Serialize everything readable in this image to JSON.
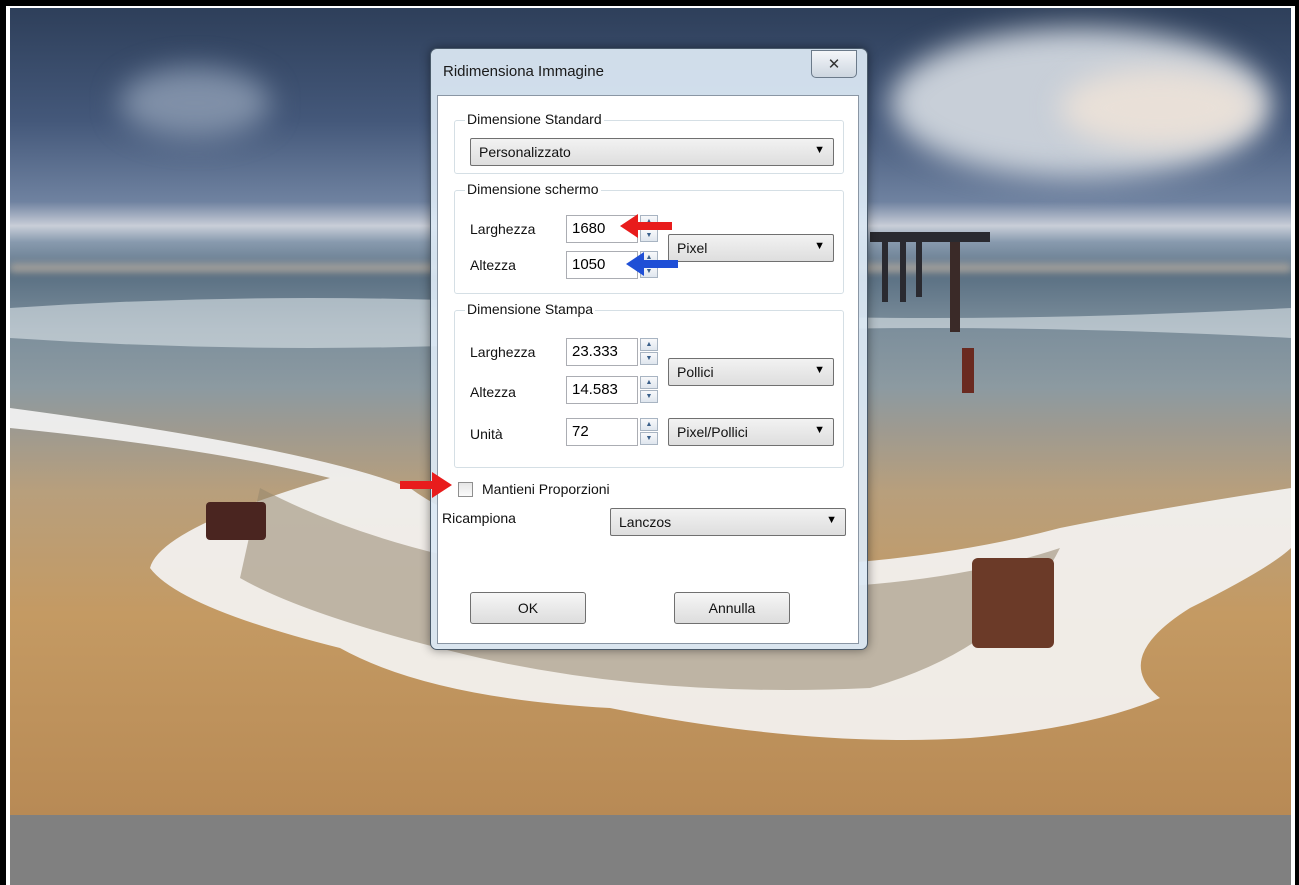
{
  "dialog": {
    "title": "Ridimensiona Immagine",
    "close_symbol": "✕",
    "standard": {
      "group_label": "Dimensione Standard",
      "selected": "Personalizzato"
    },
    "screen": {
      "group_label": "Dimensione schermo",
      "width_label": "Larghezza",
      "width_value": "1680",
      "height_label": "Altezza",
      "height_value": "1050",
      "unit_selected": "Pixel"
    },
    "print": {
      "group_label": "Dimensione Stampa",
      "width_label": "Larghezza",
      "width_value": "23.333",
      "height_label": "Altezza",
      "height_value": "14.583",
      "unit_selected": "Pollici",
      "resolution_label": "Unità",
      "resolution_value": "72",
      "resolution_unit_selected": "Pixel/Pollici"
    },
    "keep_proportions": {
      "label": "Mantieni Proporzioni",
      "checked": false
    },
    "resample": {
      "label": "Ricampiona",
      "selected": "Lanczos"
    },
    "ok_label": "OK",
    "cancel_label": "Annulla"
  },
  "spinner": {
    "up": "▲",
    "down": "▼"
  },
  "combo_arrow": "▼",
  "colors": {
    "red_arrow": "#e81c1c",
    "blue_arrow": "#1f4fd6",
    "greybar": "#808080"
  }
}
